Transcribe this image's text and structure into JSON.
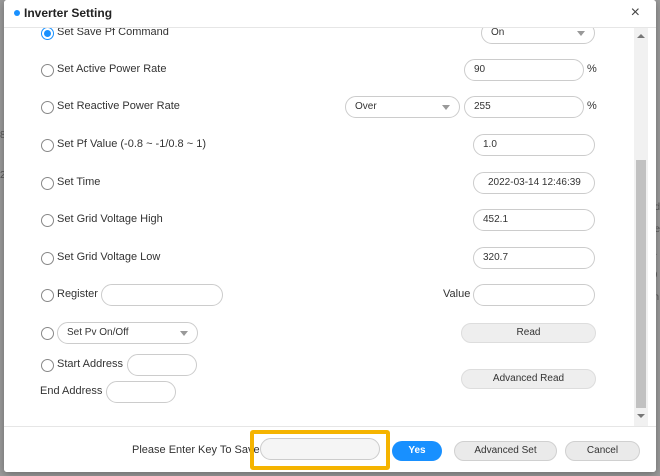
{
  "background": {
    "left_fragments": [
      "8",
      "2"
    ],
    "right_fragments": [
      "od",
      "ne",
      "5.",
      ".9",
      "lin"
    ]
  },
  "dialog": {
    "title": "Inverter Setting",
    "close_glyph": "×"
  },
  "rows": {
    "save_pf": {
      "label": "Set Save Pf Command",
      "select_value": "On",
      "checked": true
    },
    "active_power": {
      "label": "Set Active Power Rate",
      "value": "90",
      "unit": "%"
    },
    "reactive_power": {
      "label": "Set Reactive Power Rate",
      "select_value": "Over",
      "value": "255",
      "unit": "%"
    },
    "pf_value": {
      "label": "Set Pf Value (-0.8 ~ -1/0.8 ~ 1)",
      "value": "1.0"
    },
    "time": {
      "label": "Set Time",
      "value": "2022-03-14 12:46:39"
    },
    "grid_high": {
      "label": "Set Grid Voltage High",
      "value": "452.1"
    },
    "grid_low": {
      "label": "Set Grid Voltage Low",
      "value": "320.7"
    },
    "register": {
      "label": "Register",
      "value": "",
      "value_label": "Value",
      "value_field": ""
    },
    "pv": {
      "select_value": "Set Pv On/Off",
      "button": "Read"
    },
    "start_address": {
      "label": "Start Address",
      "value": ""
    },
    "end_address": {
      "label": "End Address",
      "value": "",
      "button": "Advanced Read"
    }
  },
  "footer": {
    "key_label": "Please Enter Key To Save",
    "key_value": "",
    "yes": "Yes",
    "advanced_set": "Advanced Set",
    "cancel": "Cancel"
  },
  "colors": {
    "accent": "#1890ff",
    "highlight": "#f5b400"
  }
}
